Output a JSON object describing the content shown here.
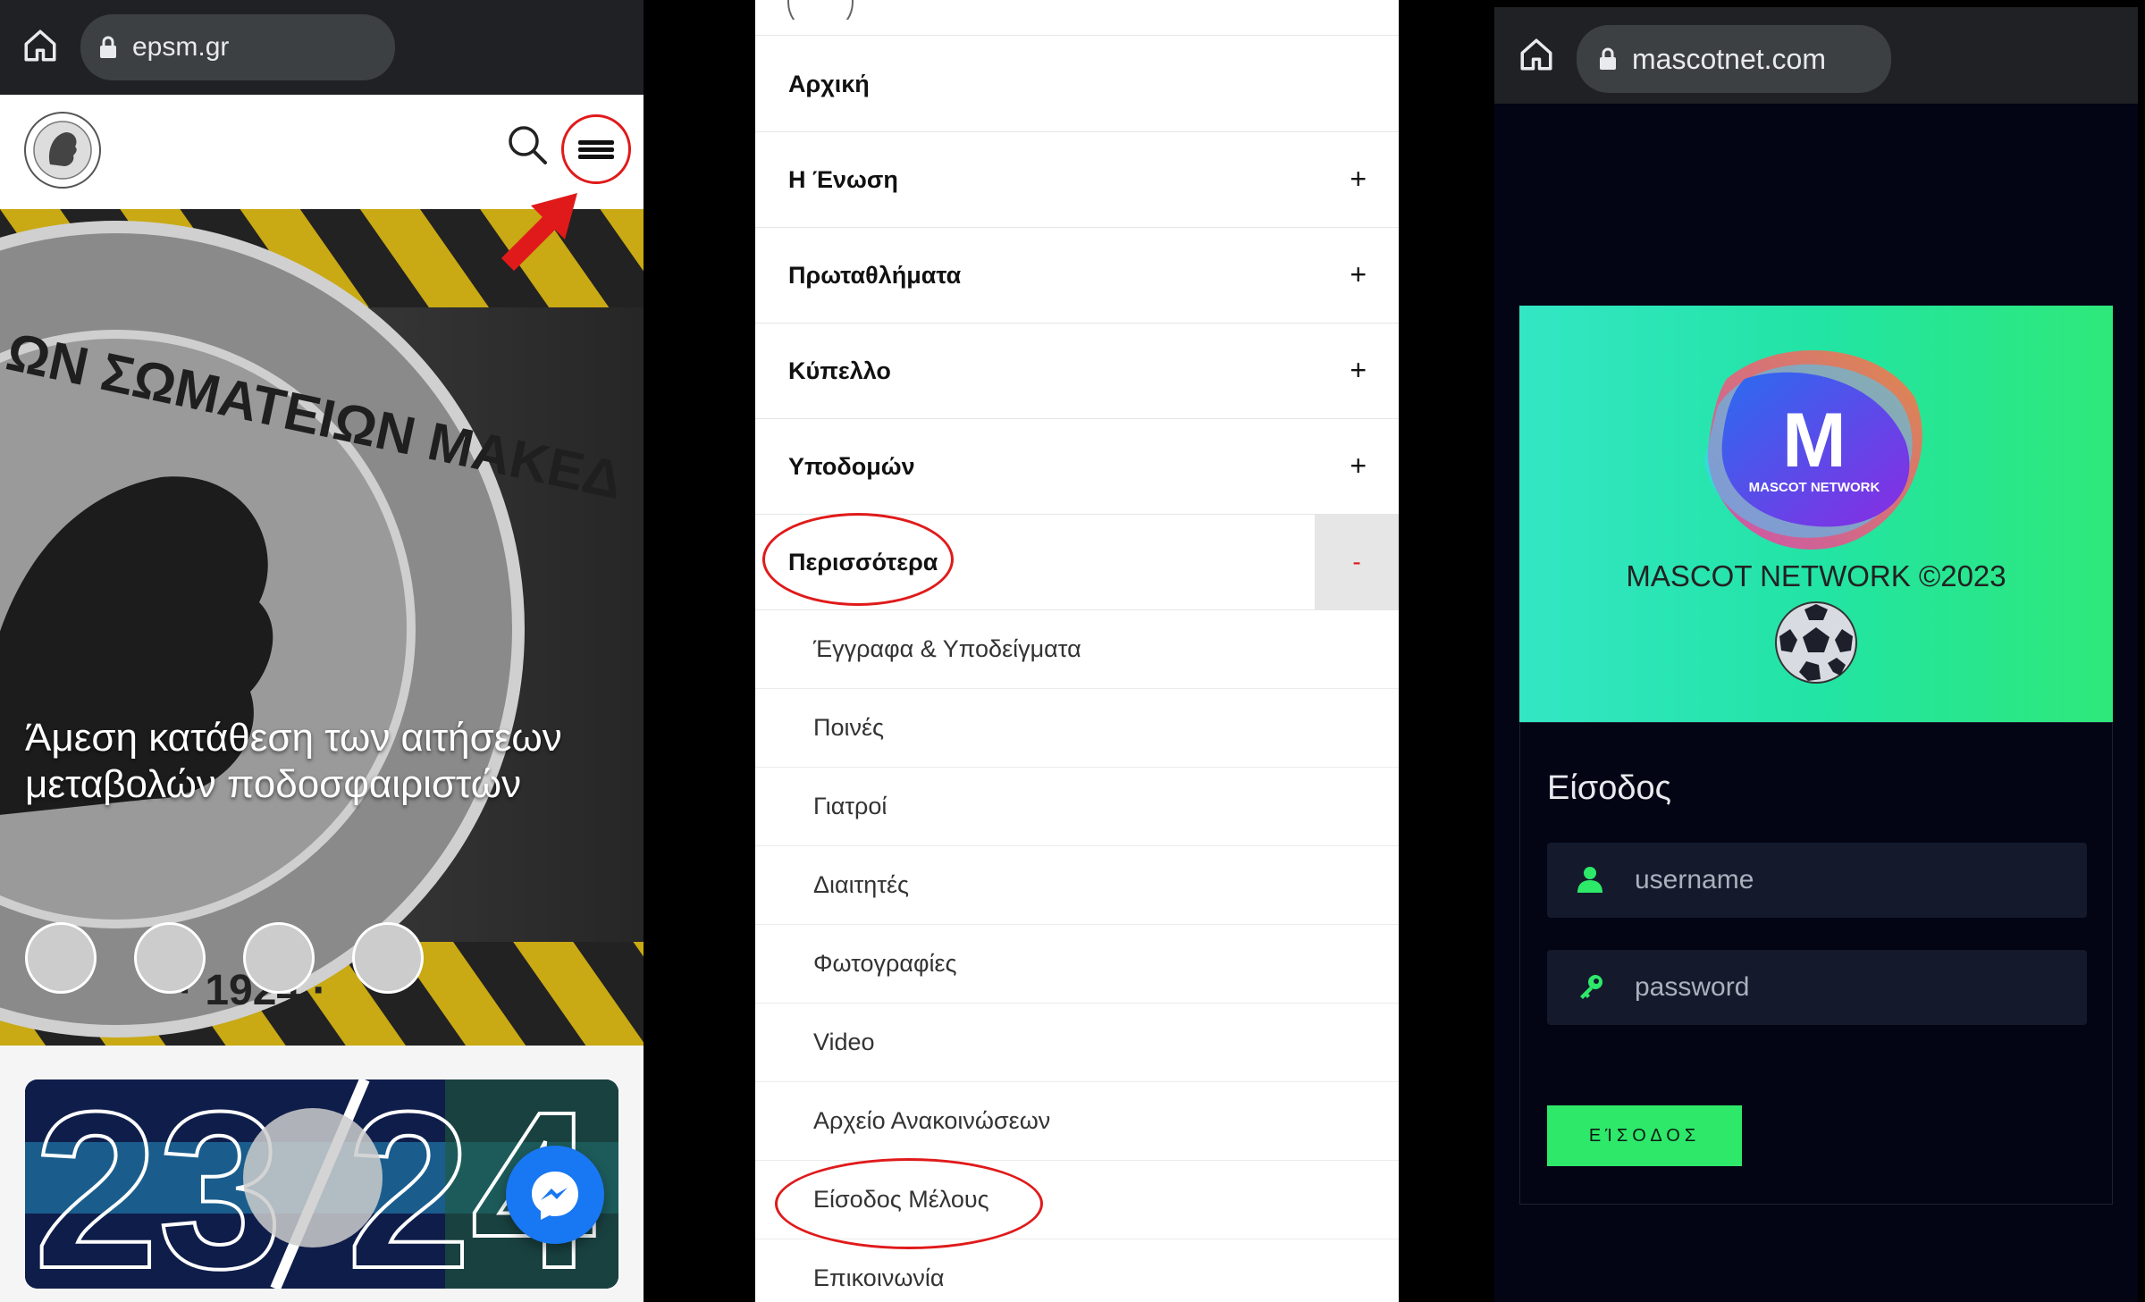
{
  "panel_epsm": {
    "url": "epsm.gr",
    "hero_caption": "Άμεση κατάθεση των αιτήσεων μεταβολών ποδοσφαιριστών",
    "seal_text_top": "ΩΝ ΣΩΜΑΤΕΙΩΝ ΜΑΚΕΔ",
    "seal_year": "· 1924 ·",
    "promo_left": "23",
    "promo_right": "24",
    "colors": {
      "accent_red": "#e01a1a",
      "messenger_blue": "#1877f2",
      "stripe_yellow": "#d4b21a"
    }
  },
  "panel_menu": {
    "items": [
      {
        "label": "Αρχική",
        "expand": ""
      },
      {
        "label": "Η Ένωση",
        "expand": "+"
      },
      {
        "label": "Πρωταθλήματα",
        "expand": "+"
      },
      {
        "label": "Κύπελλο",
        "expand": "+"
      },
      {
        "label": "Υποδομών",
        "expand": "+"
      },
      {
        "label": "Περισσότερα",
        "expand": "-"
      }
    ],
    "sub_items": [
      "Έγγραφα & Υποδείγματα",
      "Ποινές",
      "Γιατροί",
      "Διαιτητές",
      "Φωτογραφίες",
      "Video",
      "Αρχείο Ανακοινώσεων",
      "Είσοδος Μέλους",
      "Επικοινωνία"
    ]
  },
  "panel_mascot": {
    "url": "mascotnet.com",
    "logo_letter": "M",
    "logo_sub": "MASCOT NETWORK",
    "brand": "MASCOT NETWORK ©2023",
    "login_title": "Είσοδος",
    "username_placeholder": "username",
    "password_placeholder": "password",
    "login_button": "ΕΊΣΟΔΟΣ",
    "colors": {
      "accent_green": "#2ee86a",
      "page_bg": "#030514"
    }
  }
}
